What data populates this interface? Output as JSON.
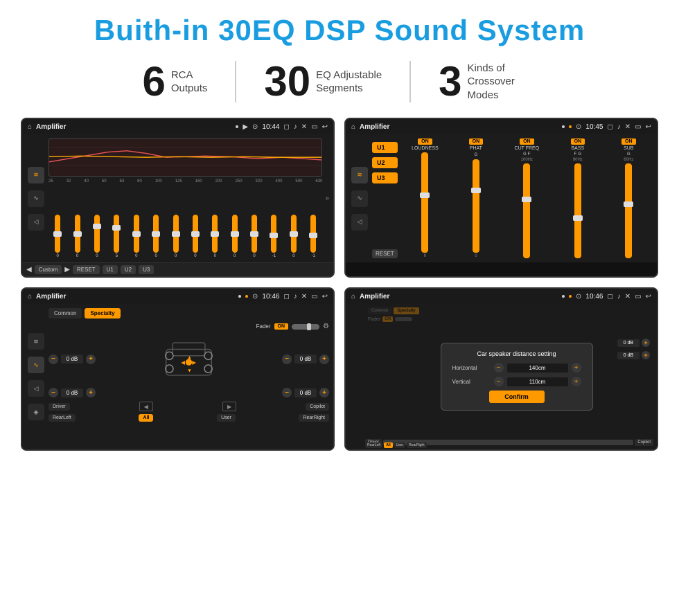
{
  "header": {
    "title": "Buith-in 30EQ DSP Sound System"
  },
  "stats": [
    {
      "number": "6",
      "line1": "RCA",
      "line2": "Outputs"
    },
    {
      "number": "30",
      "line1": "EQ Adjustable",
      "line2": "Segments"
    },
    {
      "number": "3",
      "line1": "Kinds of",
      "line2": "Crossover Modes"
    }
  ],
  "screens": {
    "eq": {
      "title": "Amplifier",
      "time": "10:44",
      "freqs": [
        "25",
        "32",
        "40",
        "50",
        "63",
        "80",
        "100",
        "125",
        "160",
        "200",
        "250",
        "320",
        "400",
        "500",
        "630"
      ],
      "values": [
        "0",
        "0",
        "0",
        "5",
        "0",
        "0",
        "0",
        "0",
        "0",
        "0",
        "0",
        "-1",
        "0",
        "-1"
      ],
      "preset": "Custom",
      "buttons": [
        "RESET",
        "U1",
        "U2",
        "U3"
      ]
    },
    "crossover": {
      "title": "Amplifier",
      "time": "10:45",
      "u_buttons": [
        "U1",
        "U2",
        "U3"
      ],
      "channels": [
        "LOUDNESS",
        "PHAT",
        "CUT FREQ",
        "BASS",
        "SUB"
      ],
      "reset": "RESET"
    },
    "fader": {
      "title": "Amplifier",
      "time": "10:46",
      "tabs": [
        "Common",
        "Specialty"
      ],
      "active_tab": "Specialty",
      "fader_label": "Fader",
      "on_label": "ON",
      "db_values": [
        "0 dB",
        "0 dB",
        "0 dB",
        "0 dB"
      ],
      "bottom_buttons": [
        "Driver",
        "",
        "",
        "Copilot",
        "RearLeft",
        "All",
        "User",
        "RearRight"
      ]
    },
    "dialog": {
      "title": "Amplifier",
      "time": "10:46",
      "tabs": [
        "Common",
        "Specialty"
      ],
      "dialog_title": "Car speaker distance setting",
      "horizontal_label": "Horizontal",
      "horizontal_value": "140cm",
      "vertical_label": "Vertical",
      "vertical_value": "110cm",
      "confirm_label": "Confirm",
      "db_values": [
        "0 dB",
        "0 dB"
      ],
      "bottom_buttons": [
        "Driver",
        "",
        "",
        "Copilot",
        "RearLeft",
        "All",
        "User",
        "RearRight"
      ]
    }
  },
  "icons": {
    "home": "⌂",
    "back": "↩",
    "location": "⊙",
    "camera": "◻",
    "volume": "♪",
    "close_x": "✕",
    "rect": "▭",
    "eq_icon": "≋",
    "wave_icon": "∿",
    "vol_icon": "◁▷",
    "speaker_icon": "◈",
    "plus": "+",
    "minus": "−",
    "prev": "◀",
    "next": "▶",
    "up_arrow": "▲",
    "down_arrow": "▼",
    "person_icon": "👤"
  }
}
